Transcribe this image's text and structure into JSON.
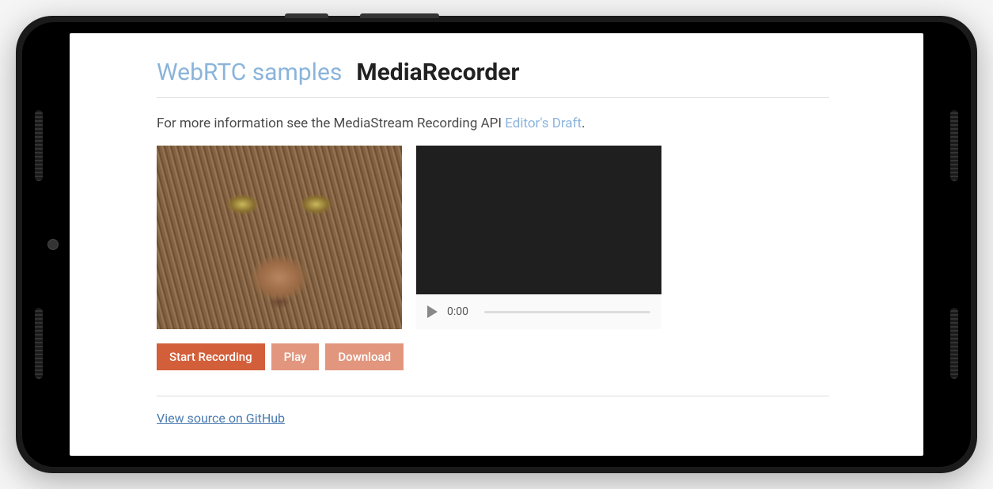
{
  "header": {
    "site_link": "WebRTC samples",
    "page_title": "MediaRecorder"
  },
  "description": {
    "prefix": "For more information see the MediaStream Recording API ",
    "link_text": "Editor's Draft",
    "suffix": "."
  },
  "player": {
    "current_time": "0:00"
  },
  "buttons": {
    "start_recording": "Start Recording",
    "play": "Play",
    "download": "Download"
  },
  "footer": {
    "github_link": "View source on GitHub"
  },
  "colors": {
    "accent": "#d35f3a",
    "link": "#8ab4db",
    "footer_link": "#4a7ab0"
  }
}
